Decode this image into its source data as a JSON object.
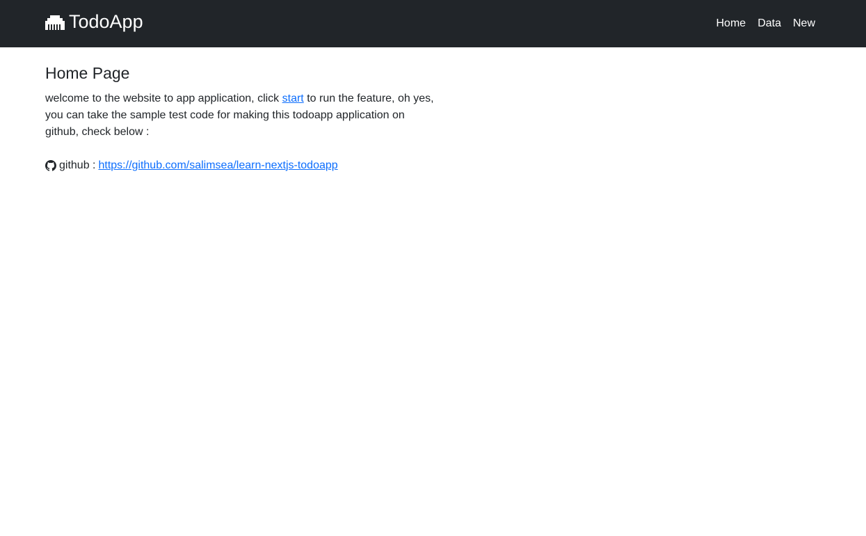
{
  "navbar": {
    "brand": "TodoApp",
    "brand_icon": "ethernet-port-icon",
    "links": [
      "Home",
      "Data",
      "New"
    ]
  },
  "main": {
    "title": "Home Page",
    "intro_before": "welcome to the website to app application, click ",
    "start_link": "start",
    "intro_after": " to run the feature, oh yes, you can take the sample test code for making this todoapp application on github, check below :",
    "github_label": "github : ",
    "github_icon": "github-icon",
    "github_url": "https://github.com/salimsea/learn-nextjs-todoapp"
  },
  "colors": {
    "navbar_bg": "#212529",
    "link": "#0d6efd",
    "text": "#212529"
  }
}
